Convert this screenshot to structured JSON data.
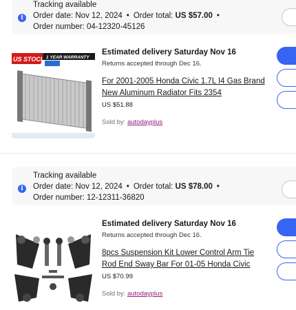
{
  "orders": [
    {
      "tracking": "Tracking available",
      "order_date": "Order date: Nov 12, 2024",
      "order_total_label": "Order total: ",
      "order_total": "US $57.00",
      "order_number": "Order number: 04-12320-45126",
      "delivery": "Estimated delivery Saturday Nov 16",
      "returns": "Returns accepted through Dec 16.",
      "title": "For 2001-2005 Honda Civic 1.7L I4 Gas Brand New Aluminum Radiator Fits 2354",
      "price": "US $51.88",
      "sold_by_label": "Sold by: ",
      "seller": "autodayplus",
      "image_banner_left": "US STOCK",
      "image_banner_right": "1 YEAR WARRANTY"
    },
    {
      "tracking": "Tracking available",
      "order_date": "Order date: Nov 12, 2024",
      "order_total_label": "Order total: ",
      "order_total": "US $78.00",
      "order_number": "Order number: 12-12311-36820",
      "delivery": "Estimated delivery Saturday Nov 16",
      "returns": "Returns accepted through Dec 16.",
      "title": "8pcs Suspension Kit Lower Control Arm Tie Rod End Sway Bar For 01-05 Honda Civic",
      "price": "US $70.99",
      "sold_by_label": "Sold by: ",
      "seller": "autodayplus"
    }
  ],
  "colors": {
    "primary": "#3665f3",
    "seller_link": "#8c1b7a",
    "header_bg": "#f7f7f7"
  },
  "icons": {
    "info": "info-icon"
  }
}
